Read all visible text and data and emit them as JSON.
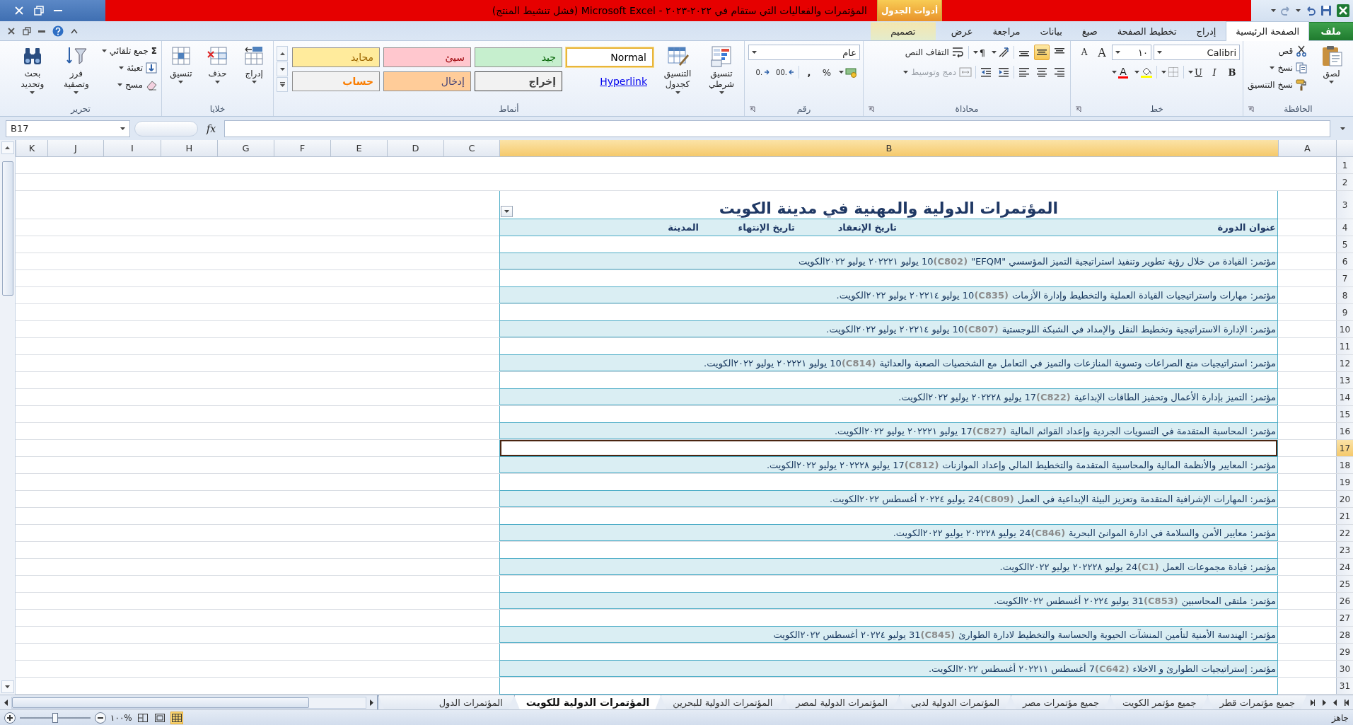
{
  "title_bar": {
    "context_tab": "أدوات الجدول",
    "title": "المؤتمرات والفعاليات التي ستقام في ٢٠٢٢-٢٠٢٣ - Microsoft Excel (فشل تنشيط المنتج)"
  },
  "ribbon_tabs": [
    {
      "label": "ملف",
      "kind": "file",
      "selected": false
    },
    {
      "label": "الصفحة الرئيسية",
      "kind": "normal",
      "selected": true
    },
    {
      "label": "إدراج",
      "kind": "normal",
      "selected": false
    },
    {
      "label": "تخطيط الصفحة",
      "kind": "normal",
      "selected": false
    },
    {
      "label": "صيغ",
      "kind": "normal",
      "selected": false
    },
    {
      "label": "بيانات",
      "kind": "normal",
      "selected": false
    },
    {
      "label": "مراجعة",
      "kind": "normal",
      "selected": false
    },
    {
      "label": "عرض",
      "kind": "normal",
      "selected": false
    },
    {
      "label": "تصميم",
      "kind": "context",
      "selected": false
    }
  ],
  "ribbon": {
    "clipboard": {
      "label": "الحافظة",
      "paste": "لصق",
      "cut": "قص",
      "copy": "نسخ",
      "format_painter": "نسخ التنسيق"
    },
    "font": {
      "label": "خط",
      "font_name": "Calibri",
      "font_size": "١٠",
      "grow": "A",
      "shrink": "A",
      "bold": "B",
      "italic": "I",
      "underline": "U",
      "font_color": "A"
    },
    "alignment": {
      "label": "محاذاة",
      "vertical": [
        {
          "selected": false
        },
        {
          "selected": true
        },
        {
          "selected": false
        }
      ],
      "paragraph": "¶",
      "wrap_text": "التفاف النص",
      "merge": {
        "label": "دمج وتوسيط",
        "disabled": true
      }
    },
    "number": {
      "label": "رقم",
      "format": "عام",
      "percent": "%",
      "comma": ",",
      "decimals": [
        ".00",
        ".0"
      ]
    },
    "styles": {
      "label": "أنماط",
      "conditional": "تنسيق شرطي",
      "as_table": "التنسيق كجدول",
      "gallery": [
        {
          "label": "Normal",
          "kind": "normal",
          "selected": true
        },
        {
          "label": "جيد",
          "kind": "good",
          "selected": false
        },
        {
          "label": "سيئ",
          "kind": "bad",
          "selected": false
        },
        {
          "label": "محايد",
          "kind": "neutral",
          "selected": false
        },
        {
          "label": "Hyperlink",
          "kind": "hyperlink",
          "selected": false
        },
        {
          "label": "إخراج",
          "kind": "output",
          "selected": false
        },
        {
          "label": "إدخال",
          "kind": "input",
          "selected": false
        },
        {
          "label": "حساب",
          "kind": "calculation",
          "selected": false
        }
      ]
    },
    "cells": {
      "label": "خلايا",
      "insert": "إدراج",
      "delete": "حذف",
      "format": "تنسيق"
    },
    "editing": {
      "label": "تحرير",
      "autosum_symbol": "Σ",
      "autosum": "جمع تلقائي",
      "fill": "تعبئة",
      "clear": "مسح",
      "sort": "فرز وتصفية",
      "find": "بحث وتحديد"
    }
  },
  "formula_bar": {
    "name_box": "B17",
    "fx": "fx"
  },
  "columns": [
    {
      "label": "A",
      "selected": false
    },
    {
      "label": "B",
      "selected": true
    },
    {
      "label": "C",
      "selected": false
    },
    {
      "label": "D",
      "selected": false
    },
    {
      "label": "E",
      "selected": false
    },
    {
      "label": "F",
      "selected": false
    },
    {
      "label": "G",
      "selected": false
    },
    {
      "label": "H",
      "selected": false
    },
    {
      "label": "I",
      "selected": false
    },
    {
      "label": "J",
      "selected": false
    },
    {
      "label": "K",
      "selected": false
    }
  ],
  "rows": [
    {
      "number": "1",
      "kind": "blank",
      "selected": false
    },
    {
      "number": "2",
      "kind": "blank",
      "selected": false
    },
    {
      "number": "3",
      "kind": "title",
      "text": "المؤتمرات الدولية والمهنية في مدينة الكويت",
      "selected": false
    },
    {
      "number": "4",
      "kind": "header",
      "cells": [
        "عنوان الدورة",
        "تاريخ الإنعقاد",
        "تاريخ الإنتهاء",
        "المدينة"
      ],
      "selected": false
    },
    {
      "number": "5",
      "kind": "band",
      "selected": false
    },
    {
      "number": "6",
      "kind": "entry",
      "text": "مؤتمر: القيادة من خلال رؤية تطوير وتنفيذ استراتيجية التميز المؤسسي \"EFQM\" **(C802)**10 يوليو ٢٠٢٢٢١ يوليو ٢٠٢٢الكويت",
      "selected": false
    },
    {
      "number": "7",
      "kind": "band",
      "selected": false
    },
    {
      "number": "8",
      "kind": "entry",
      "text": "مؤتمر: مهارات واستراتيجيات القيادة العملية والتخطيط وإدارة الأزمات **(C835)**10 يوليو ٢٠٢٢١٤ يوليو ٢٠٢٢الكويت.",
      "selected": false
    },
    {
      "number": "9",
      "kind": "band",
      "selected": false
    },
    {
      "number": "10",
      "kind": "entry",
      "text": "مؤتمر: الإدارة الاستراتيجية وتخطيط النقل والإمداد في الشبكة اللوجستية **(C807)**10 يوليو ٢٠٢٢١٤ يوليو ٢٠٢٢الكويت.",
      "selected": false
    },
    {
      "number": "11",
      "kind": "band",
      "selected": false
    },
    {
      "number": "12",
      "kind": "entry",
      "text": "مؤتمر: استراتيجيات منع الصراعات وتسوية المنازعات والتميز في التعامل مع الشخصيات الصعبة والعدائية **(C814)**10 يوليو ٢٠٢٢٢١ يوليو ٢٠٢٢الكويت.",
      "selected": false
    },
    {
      "number": "13",
      "kind": "band",
      "selected": false
    },
    {
      "number": "14",
      "kind": "entry",
      "text": "مؤتمر: التميز بإدارة الأعمال وتحفيز الطاقات الإبداعية **(C822)**17 يوليو ٢٠٢٢٢٨ يوليو ٢٠٢٢الكويت.",
      "selected": false
    },
    {
      "number": "15",
      "kind": "band",
      "selected": false
    },
    {
      "number": "16",
      "kind": "entry",
      "text": "مؤتمر: المحاسبة المتقدمة في التسويات الجردية وإعداد القوائم المالية **(C827)**17 يوليو ٢٠٢٢٢١ يوليو ٢٠٢٢الكويت.",
      "selected": false
    },
    {
      "number": "17",
      "kind": "band",
      "selected": true
    },
    {
      "number": "18",
      "kind": "entry",
      "text": "مؤتمر: المعايير والأنظمة المالية والمحاسبية المتقدمة والتخطيط المالي وإعداد الموازنات **(C812)**17 يوليو ٢٠٢٢٢٨ يوليو ٢٠٢٢الكويت.",
      "selected": false
    },
    {
      "number": "19",
      "kind": "band",
      "selected": false
    },
    {
      "number": "20",
      "kind": "entry",
      "text": "مؤتمر: المهارات الإشرافية المتقدمة وتعزيز البيئة الإبداعية في العمل **(C809)**24 يوليو ٢٠٢٢٤ أغسطس ٢٠٢٢الكويت.",
      "selected": false
    },
    {
      "number": "21",
      "kind": "band",
      "selected": false
    },
    {
      "number": "22",
      "kind": "entry",
      "text": "مؤتمر: معايير الأمن والسلامة في ادارة الموانئ البحرية **(C846)**24 يوليو ٢٠٢٢٢٨ يوليو ٢٠٢٢الكويت.",
      "selected": false
    },
    {
      "number": "23",
      "kind": "band",
      "selected": false
    },
    {
      "number": "24",
      "kind": "entry",
      "text": "مؤتمر: قيادة مجموعات العمل **(C1)**24 يوليو ٢٠٢٢٢٨ يوليو ٢٠٢٢الكويت.",
      "selected": false
    },
    {
      "number": "25",
      "kind": "band",
      "selected": false
    },
    {
      "number": "26",
      "kind": "entry",
      "text": "مؤتمر: ملتقى المحاسبين **(C853)**31 يوليو ٢٠٢٢٤ أغسطس ٢٠٢٢الكويت.",
      "selected": false
    },
    {
      "number": "27",
      "kind": "band",
      "selected": false
    },
    {
      "number": "28",
      "kind": "entry",
      "text": "مؤتمر: الهندسة الأمنية لتأمين المنشآت الحيوية والحساسة والتخطيط لادارة الطوارئ **(C845)**31 يوليو ٢٠٢٢٤ أغسطس ٢٠٢٢الكويت",
      "selected": false
    },
    {
      "number": "29",
      "kind": "band",
      "selected": false
    },
    {
      "number": "30",
      "kind": "entry",
      "text": "مؤتمر: إستراتيجيات الطوارئ و الاخلاء **(C642)**7 أغسطس ٢٠٢٢١١ أغسطس ٢٠٢٢الكويت.",
      "selected": false
    },
    {
      "number": "31",
      "kind": "band",
      "selected": false
    }
  ],
  "sheet_tabs": [
    {
      "label": "جميع مؤتمرات قطر",
      "selected": false
    },
    {
      "label": "جميع مؤتمر الكويت",
      "selected": false
    },
    {
      "label": "جميع مؤتمرات مصر",
      "selected": false
    },
    {
      "label": "المؤتمرات الدولية لدبي",
      "selected": false
    },
    {
      "label": "المؤتمرات الدولية لمصر",
      "selected": false
    },
    {
      "label": "المؤتمرات الدولية للبحرين",
      "selected": false
    },
    {
      "label": "المؤتمرات الدولية للكويت",
      "selected": true
    },
    {
      "label": "المؤتمرات الدول",
      "selected": false
    }
  ],
  "status_bar": {
    "status": "جاهز",
    "views": [
      {
        "selected": true
      },
      {
        "selected": false
      },
      {
        "selected": false
      }
    ],
    "zoom": "%١٠٠",
    "zoom_slider": {
      "level": 0.5
    }
  }
}
